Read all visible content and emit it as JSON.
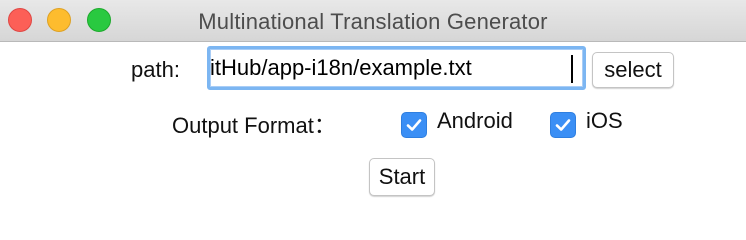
{
  "window": {
    "title": "Multinational Translation Generator"
  },
  "path": {
    "label": "path:",
    "value": "itHub/app-i18n/example.txt",
    "select_label": "select"
  },
  "output": {
    "label": "Output Format：",
    "options": [
      {
        "label": "Android",
        "checked": true
      },
      {
        "label": "iOS",
        "checked": true
      }
    ]
  },
  "actions": {
    "start_label": "Start"
  },
  "colors": {
    "accent": "#3b8ff5",
    "focus_ring": "#7cb6f2",
    "close": "#fc5f57",
    "minimize": "#fdbc2e",
    "zoom": "#29c940"
  }
}
